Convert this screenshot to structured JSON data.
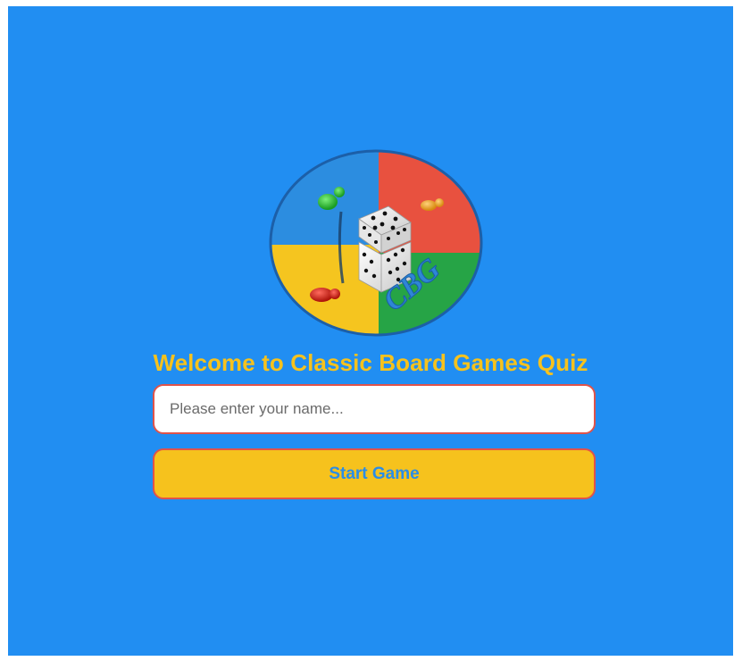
{
  "logo": {
    "icon": "board-game-logo-icon",
    "lettering": "CBG",
    "colors": {
      "blue": "#2c8de0",
      "red": "#e8513f",
      "yellow": "#f5c51f",
      "green": "#26a446"
    }
  },
  "welcome": {
    "title": "Welcome to Classic Board Games Quiz"
  },
  "name_input": {
    "value": "",
    "placeholder": "Please enter your name..."
  },
  "start_button": {
    "label": "Start Game"
  },
  "theme": {
    "background": "#218ef2",
    "accent": "#f6c21d",
    "border": "#e0534a"
  }
}
